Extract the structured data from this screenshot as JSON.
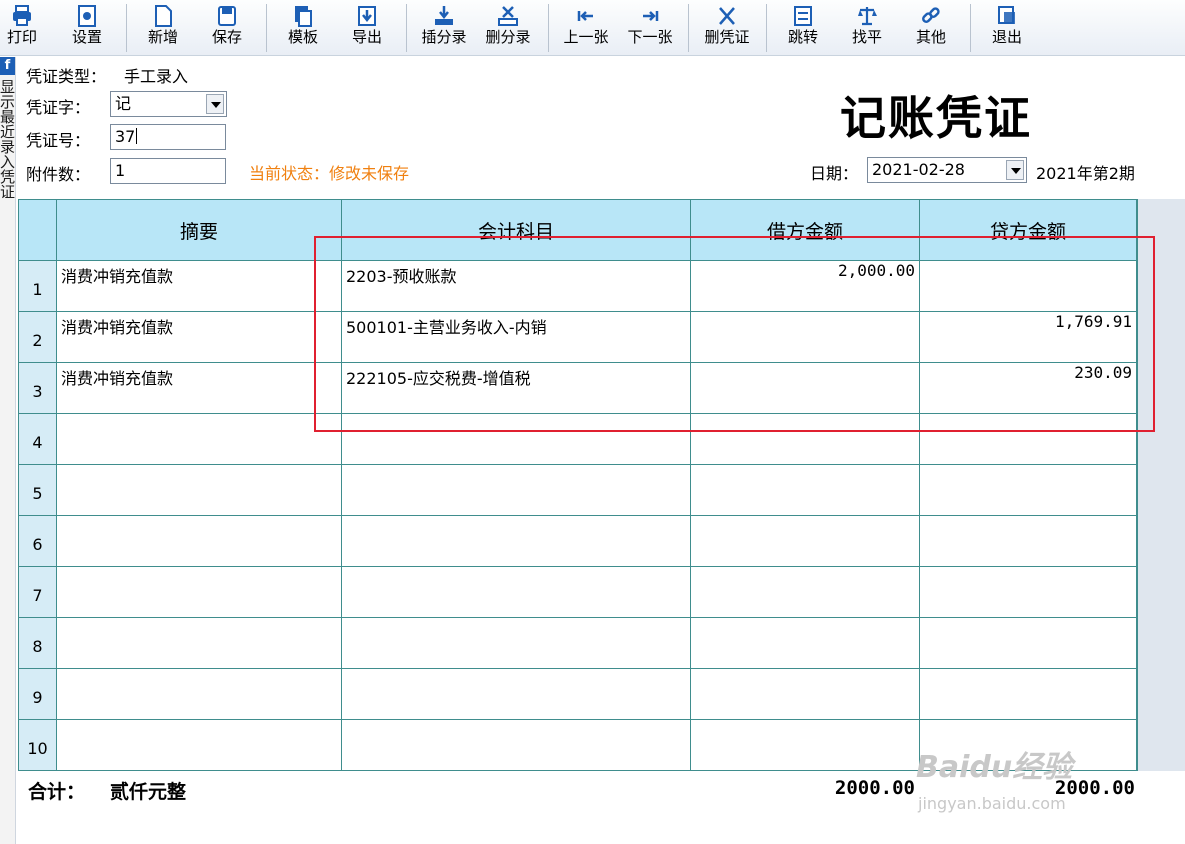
{
  "toolbar": {
    "items": [
      {
        "label": "打印",
        "icon": "printer-icon"
      },
      {
        "label": "设置",
        "icon": "settings-icon"
      },
      {
        "label": "新增",
        "icon": "new-document-icon"
      },
      {
        "label": "保存",
        "icon": "save-icon"
      },
      {
        "label": "模板",
        "icon": "template-icon"
      },
      {
        "label": "导出",
        "icon": "export-icon"
      },
      {
        "label": "插分录",
        "icon": "insert-entry-icon"
      },
      {
        "label": "删分录",
        "icon": "delete-entry-icon"
      },
      {
        "label": "上一张",
        "icon": "previous-icon"
      },
      {
        "label": "下一张",
        "icon": "next-icon"
      },
      {
        "label": "删凭证",
        "icon": "delete-voucher-icon"
      },
      {
        "label": "跳转",
        "icon": "jump-icon"
      },
      {
        "label": "找平",
        "icon": "balance-scale-icon"
      },
      {
        "label": "其他",
        "icon": "link-icon"
      },
      {
        "label": "退出",
        "icon": "exit-icon"
      }
    ]
  },
  "sidebar": {
    "flag": "f",
    "vertical_text": "显示最近录入凭证"
  },
  "voucher": {
    "type_label": "凭证类型：",
    "type_value": "手工录入",
    "word_label": "凭证字：",
    "word_value": "记",
    "number_label": "凭证号：",
    "number_value": "37",
    "attach_label": "附件数：",
    "attach_value": "1",
    "status": "当前状态：修改未保存",
    "title": "记账凭证",
    "date_label": "日期：",
    "date_value": "2021-02-28",
    "period": "2021年第2期"
  },
  "grid": {
    "headers": [
      "摘要",
      "会计科目",
      "借方金额",
      "贷方金额"
    ],
    "rows": [
      {
        "no": "1",
        "summary": "消费冲销充值款",
        "account": "2203-预收账款",
        "debit": "2,000.00",
        "credit": ""
      },
      {
        "no": "2",
        "summary": "消费冲销充值款",
        "account": "500101-主营业务收入-内销",
        "debit": "",
        "credit": "1,769.91"
      },
      {
        "no": "3",
        "summary": "消费冲销充值款",
        "account": "222105-应交税费-增值税",
        "debit": "",
        "credit": "230.09"
      },
      {
        "no": "4",
        "summary": "",
        "account": "",
        "debit": "",
        "credit": ""
      },
      {
        "no": "5",
        "summary": "",
        "account": "",
        "debit": "",
        "credit": ""
      },
      {
        "no": "6",
        "summary": "",
        "account": "",
        "debit": "",
        "credit": ""
      },
      {
        "no": "7",
        "summary": "",
        "account": "",
        "debit": "",
        "credit": ""
      },
      {
        "no": "8",
        "summary": "",
        "account": "",
        "debit": "",
        "credit": ""
      },
      {
        "no": "9",
        "summary": "",
        "account": "",
        "debit": "",
        "credit": ""
      },
      {
        "no": "10",
        "summary": "",
        "account": "",
        "debit": "",
        "credit": ""
      }
    ]
  },
  "totals": {
    "label": "合计：",
    "words": "贰仟元整",
    "debit": "2000.00",
    "credit": "2000.00"
  },
  "watermark": {
    "brand": "Baidu经验",
    "url": "jingyan.baidu.com"
  },
  "colors": {
    "accent": "#1d5fb5",
    "status": "#f08010",
    "header_bg": "#b8e6f7",
    "grid_line": "#3f8d8d",
    "annotation": "#e02030"
  }
}
